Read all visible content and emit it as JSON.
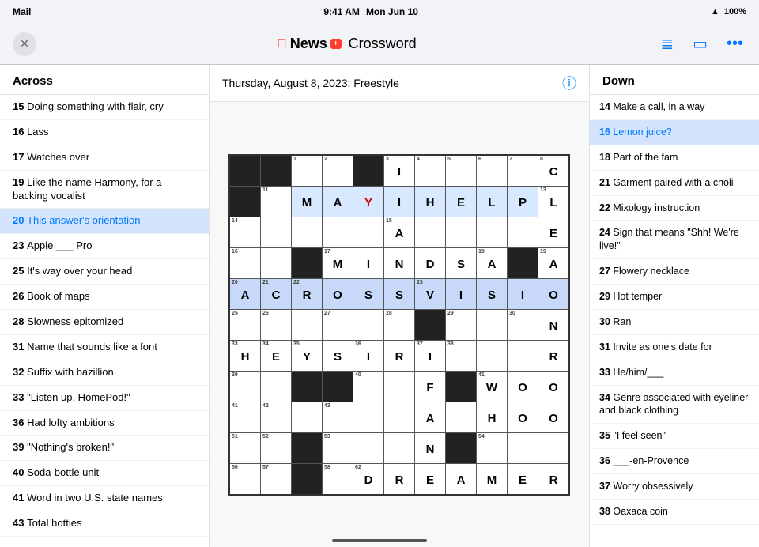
{
  "statusBar": {
    "carrier": "Mail",
    "time": "9:41 AM",
    "date": "Mon Jun 10",
    "dotsMenu": "...",
    "wifi": "WiFi",
    "battery": "100%"
  },
  "toolbar": {
    "closeLabel": "✕",
    "appleLogo": "",
    "newsLabel": "News",
    "plusLabel": "+",
    "crosswordLabel": "Crossword",
    "listIconLabel": "☰",
    "personIconLabel": "⊡",
    "moreIconLabel": "•••"
  },
  "crosswordHeader": {
    "date": "Thursday, August 8, 2023: Freestyle"
  },
  "acrossClues": {
    "header": "Across",
    "items": [
      {
        "number": "15",
        "text": "Doing something with flair, cry"
      },
      {
        "number": "16",
        "text": "Lass"
      },
      {
        "number": "17",
        "text": "Watches over"
      },
      {
        "number": "19",
        "text": "Like the name Harmony, for a backing vocalist"
      },
      {
        "number": "20",
        "text": "This answer's orientation",
        "active": true
      },
      {
        "number": "23",
        "text": "Apple ___ Pro"
      },
      {
        "number": "25",
        "text": "It's way over your head"
      },
      {
        "number": "26",
        "text": "Book of maps"
      },
      {
        "number": "28",
        "text": "Slowness epitomized"
      },
      {
        "number": "31",
        "text": "Name that sounds like a font"
      },
      {
        "number": "32",
        "text": "Suffix with bazillion"
      },
      {
        "number": "33",
        "text": "\"Listen up, HomePod!\""
      },
      {
        "number": "36",
        "text": "Had lofty ambitions"
      },
      {
        "number": "39",
        "text": "\"Nothing's broken!\""
      },
      {
        "number": "40",
        "text": "Soda-bottle unit"
      },
      {
        "number": "41",
        "text": "Word in two U.S. state names"
      },
      {
        "number": "43",
        "text": "Total hotties"
      }
    ]
  },
  "downClues": {
    "header": "Down",
    "items": [
      {
        "number": "14",
        "text": "Make a call, in a way"
      },
      {
        "number": "16",
        "text": "Lemon juice?",
        "active": true
      },
      {
        "number": "18",
        "text": "Part of the fam"
      },
      {
        "number": "21",
        "text": "Garment paired with a choli"
      },
      {
        "number": "22",
        "text": "Mixology instruction"
      },
      {
        "number": "24",
        "text": "Sign that means \"Shh! We're live!\""
      },
      {
        "number": "27",
        "text": "Flowery necklace"
      },
      {
        "number": "29",
        "text": "Hot temper"
      },
      {
        "number": "30",
        "text": "Ran"
      },
      {
        "number": "31",
        "text": "Invite as one's date for"
      },
      {
        "number": "33",
        "text": "He/him/___"
      },
      {
        "number": "34",
        "text": "Genre associated with eyeliner and black clothing"
      },
      {
        "number": "35",
        "text": "\"I feel seen\""
      },
      {
        "number": "36",
        "text": "___-en-Provence"
      },
      {
        "number": "37",
        "text": "Worry obsessively"
      },
      {
        "number": "38",
        "text": "Oaxaca coin"
      }
    ]
  },
  "grid": {
    "cols": 11,
    "rows": 11
  }
}
